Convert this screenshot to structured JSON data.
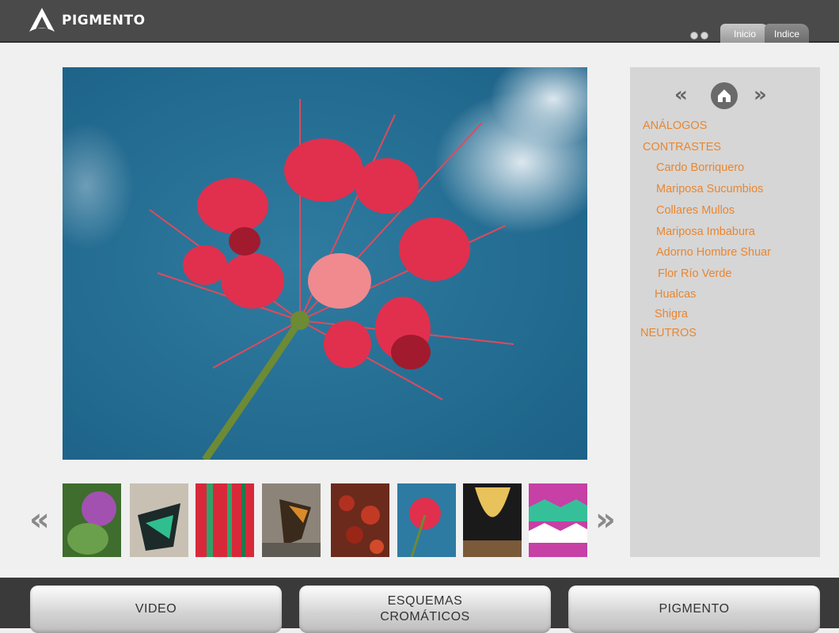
{
  "header": {
    "brand": "PIGMENTO",
    "tabs": [
      {
        "label": "Inicio"
      },
      {
        "label": "Indice"
      }
    ]
  },
  "sidebar": {
    "categories": [
      {
        "label": "ANÁLOGOS"
      },
      {
        "label": "CONTRASTES"
      },
      {
        "label": "NEUTROS"
      }
    ],
    "items": [
      {
        "label": "Cardo Borriquero"
      },
      {
        "label": "Mariposa Sucumbios"
      },
      {
        "label": "Collares Mullos"
      },
      {
        "label": "Mariposa Imbabura"
      },
      {
        "label": "Adorno Hombre Shuar"
      },
      {
        "label": "Flor Río Verde"
      },
      {
        "label": "Hualcas"
      },
      {
        "label": "Shigra"
      }
    ],
    "accent_color": "#e9862f"
  },
  "gallery": {
    "prev_glyph": "«",
    "next_glyph": "»"
  },
  "footer": {
    "buttons": [
      {
        "label": "VIDEO"
      },
      {
        "label_line1": "ESQUEMAS",
        "label_line2": "CROMÁTICOS"
      },
      {
        "label": "PIGMENTO"
      }
    ]
  }
}
